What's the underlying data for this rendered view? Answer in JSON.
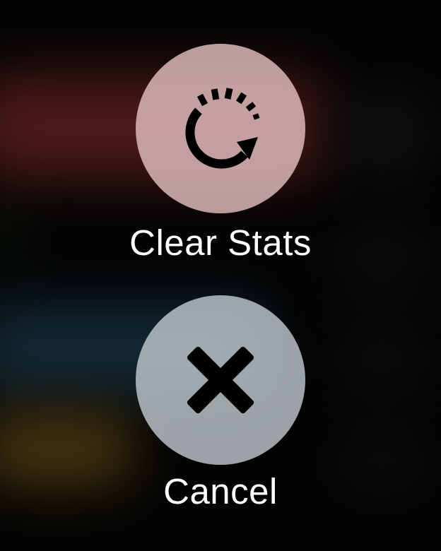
{
  "actions": {
    "clear_stats": {
      "label": "Clear Stats",
      "icon": "reset-icon"
    },
    "cancel": {
      "label": "Cancel",
      "icon": "close-icon"
    }
  },
  "colors": {
    "icon": "#000000",
    "label": "#ffffff"
  }
}
